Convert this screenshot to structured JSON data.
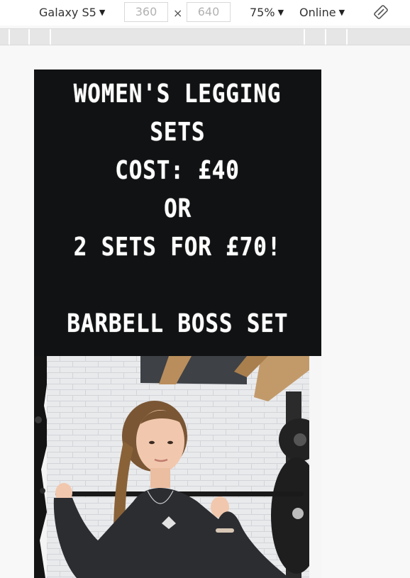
{
  "toolbar": {
    "device": "Galaxy S5",
    "width": "360",
    "height": "640",
    "times": "×",
    "zoom": "75%",
    "network": "Online"
  },
  "promo": {
    "line1": "WOMEN'S LEGGING",
    "line2": "SETS",
    "line3": "COST: £40",
    "line4": "OR",
    "line5": "2 SETS FOR £70!",
    "line6": "BARBELL BOSS SET"
  },
  "colors": {
    "promo_bg": "#111213",
    "toolbar_bg": "#ffffff",
    "ruler_bg": "#e6e6e6"
  },
  "icons": {
    "rotate": "rotate-icon",
    "caret": "chevron-down-icon"
  }
}
